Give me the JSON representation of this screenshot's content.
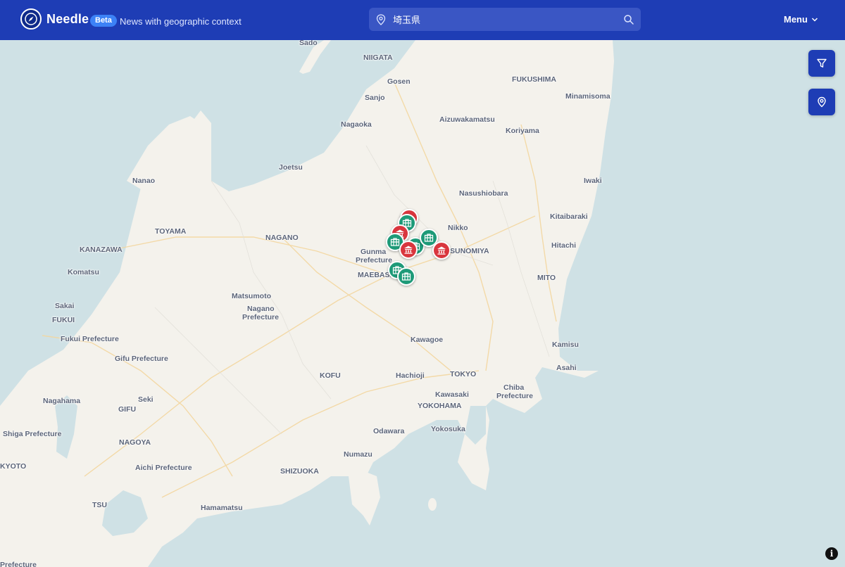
{
  "header": {
    "brand": "Needle",
    "badge": "Beta",
    "tagline": "News with geographic context",
    "search_value": "埼玉県",
    "menu_label": "Menu"
  },
  "colors": {
    "header": "#1e3db5",
    "badge": "#3c82f6",
    "marker_red": "#d9363e",
    "marker_green": "#1d9a78",
    "sea": "#cfe1e5",
    "land": "#f4f2ec"
  },
  "map": {
    "cities": [
      "Sado",
      "NIIGATA",
      "Gosen",
      "Sanjo",
      "FUKUSHIMA",
      "Minamisoma",
      "Nagaoka",
      "Aizuwakamatsu",
      "Koriyama",
      "Joetsu",
      "Nanao",
      "Nasushiobara",
      "Iwaki",
      "Kitaibaraki",
      "TOYAMA",
      "NAGANO",
      "Nikko",
      "Gunma",
      "Prefecture",
      "UTSUNOMIYA",
      "Hitachi",
      "KANAZAWA",
      "Komatsu",
      "MAEBASHI",
      "MITO",
      "Matsumoto",
      "Sakai",
      "Nagano",
      "Prefecture",
      "FUKUI",
      "Kawagoe",
      "Fukui Prefecture",
      "Kamisu",
      "Gifu Prefecture",
      "Asahi",
      "KOFU",
      "Hachioji",
      "TOKYO",
      "Seki",
      "Chiba",
      "Prefecture",
      "Kawasaki",
      "Nagahama",
      "GIFU",
      "YOKOHAMA",
      "Shiga Prefecture",
      "Odawara",
      "Yokosuka",
      "NAGOYA",
      "Numazu",
      "KYOTO",
      "Aichi Prefecture",
      "SHIZUOKA",
      "TSU",
      "Hamamatsu",
      "Prefecture"
    ],
    "marker_types": {
      "red": "government-building",
      "green": "briefcase"
    }
  },
  "controls": {
    "filter": "filter-icon",
    "locate": "map-pin-icon",
    "info": "i"
  }
}
